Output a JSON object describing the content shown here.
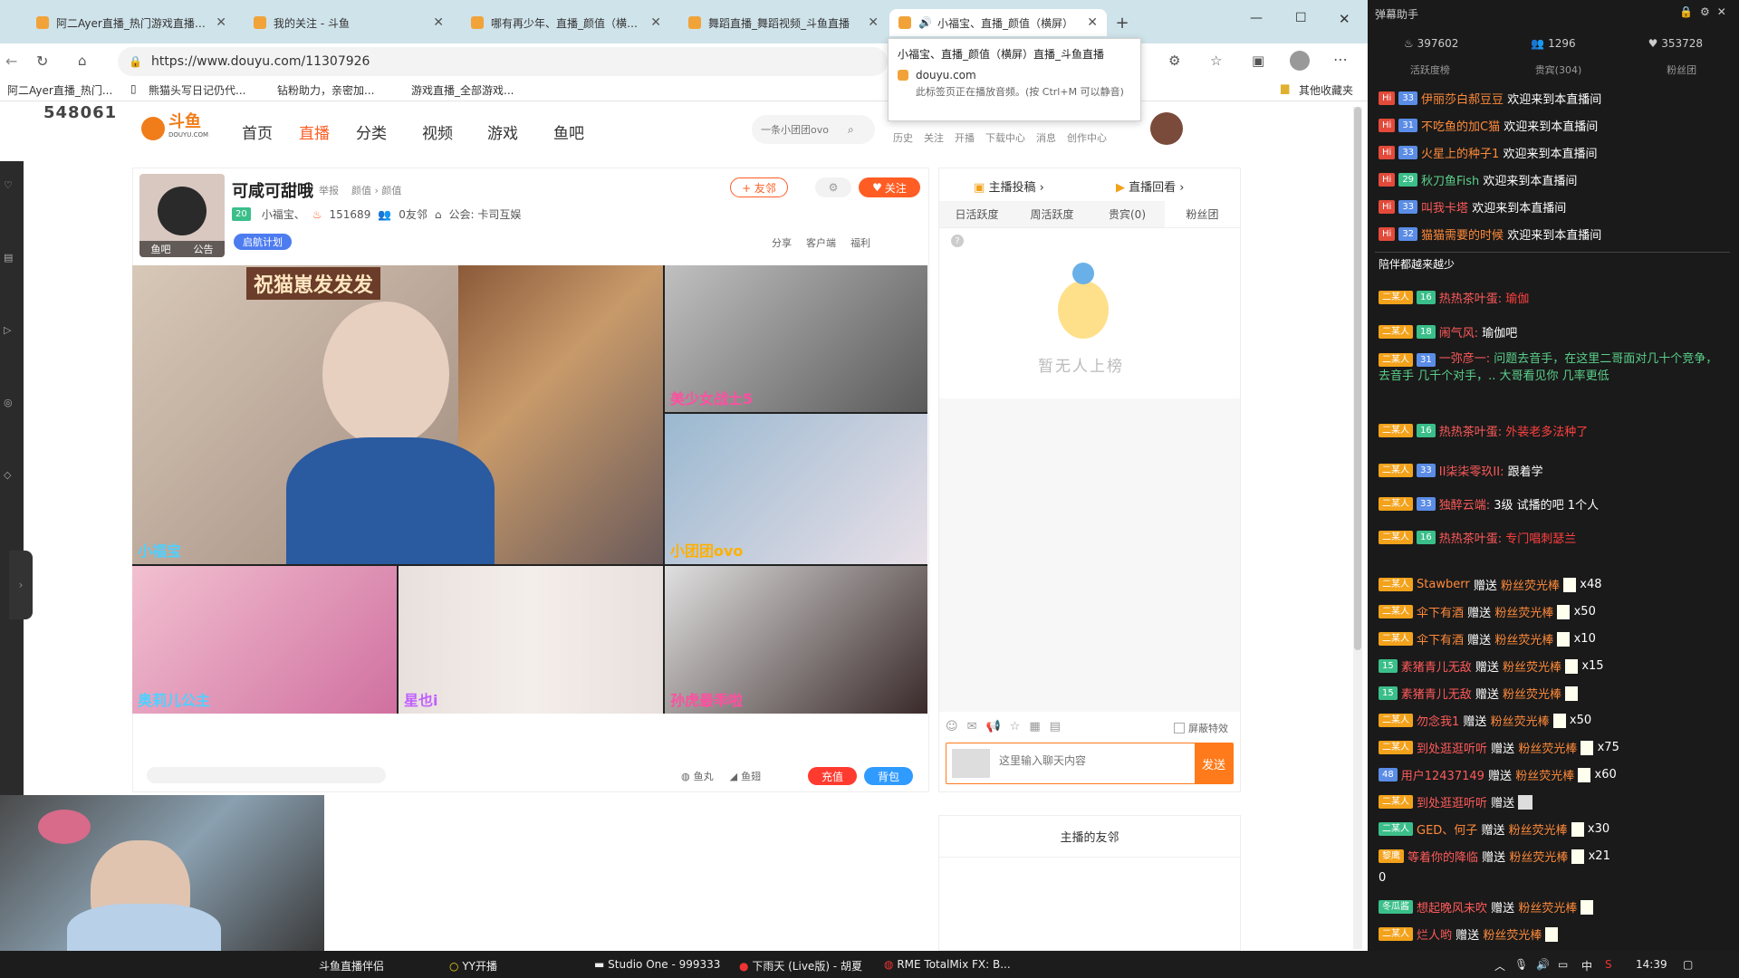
{
  "browser": {
    "tabs": [
      {
        "title": "阿二Ayer直播_热门游戏直播_斗鱼"
      },
      {
        "title": "我的关注 - 斗鱼"
      },
      {
        "title": "哪有再少年、直播_颜值（横屏）"
      },
      {
        "title": "舞蹈直播_舞蹈视频_斗鱼直播"
      },
      {
        "title": "小福宝、直播_颜值（横屏）"
      }
    ],
    "url": "https://www.douyu.com/11307926",
    "tooltip": {
      "title": "小福宝、直播_颜值（横屏）直播_斗鱼直播",
      "domain": "douyu.com",
      "note": "此标签页正在播放音频。(按 Ctrl+M 可以静音)"
    },
    "bookmarks": [
      {
        "label": "阿二Ayer直播_热门..."
      },
      {
        "label": "熊猫头写日记仍代..."
      },
      {
        "label": "钻粉助力，亲密加..."
      },
      {
        "label": "游戏直播_全部游戏..."
      }
    ],
    "other_bookmarks": "其他收藏夹"
  },
  "site": {
    "counter": "548061",
    "logo_text": "斗鱼",
    "logo_sub": "DOUYU.COM",
    "nav": [
      "首页",
      "直播",
      "分类",
      "视频",
      "游戏",
      "鱼吧"
    ],
    "search_placeholder": "一条小团团ovo",
    "top_icons": [
      "历史",
      "关注",
      "开播",
      "下载中心",
      "消息",
      "创作中心"
    ]
  },
  "streamer": {
    "name": "可咸可甜哦",
    "report": "举报",
    "category": "颜值 › 颜值",
    "level": "20",
    "fan_name": "小福宝、",
    "hot": "151689",
    "friends": "0友邻",
    "guild": "公会: 卡司互娱",
    "avatar_tabs": [
      "鱼吧",
      "公告"
    ],
    "plan_btn": "启航计划",
    "add_friend": "+ 友邻",
    "follow": "关注",
    "share": "分享",
    "client": "客户端",
    "welfare": "福利"
  },
  "video": {
    "banner": "祝猫崽发发发",
    "names": [
      "小福宝",
      "美少女战士5",
      "小团团ovo",
      "奥莉儿公主",
      "星也i",
      "孙虎最乖啦"
    ]
  },
  "gifts_bar": {
    "fishball": "鱼丸",
    "fishwing": "鱼翅",
    "recharge": "充值",
    "backpack": "背包"
  },
  "rank": {
    "top_links": [
      "主播投稿 ›",
      "直播回看 ›"
    ],
    "tabs": [
      "日活跃度",
      "周活跃度",
      "贵宾(0)",
      "粉丝团"
    ],
    "empty_text": "暂无人上榜",
    "chat_placeholder": "这里输入聊天内容",
    "send": "发送",
    "block": "屏蔽特效",
    "friends_title": "主播的友邻"
  },
  "danmu": {
    "title": "弹幕助手",
    "stats": [
      "397602",
      "1296",
      "353728"
    ],
    "subtabs": [
      "活跃度榜",
      "贵宾(304)",
      "粉丝团"
    ],
    "welcome": [
      {
        "lv": "33",
        "name": "伊丽莎白郝豆豆",
        "text": "欢迎来到本直播间"
      },
      {
        "lv": "31",
        "name": "不吃鱼的加C猫",
        "text": "欢迎来到本直播间"
      },
      {
        "lv": "33",
        "name": "火星上的种子1",
        "text": "欢迎来到本直播间"
      },
      {
        "lv": "29",
        "name": "秋刀鱼Fish",
        "text": "欢迎来到本直播间"
      },
      {
        "lv": "33",
        "name": "叫我卡塔",
        "text": "欢迎来到本直播间"
      },
      {
        "lv": "32",
        "name": "猫猫需要的时候",
        "text": "欢迎来到本直播间"
      }
    ],
    "divider": "陪伴都越来越少",
    "chats": [
      {
        "badge": "二某人",
        "lv": "16",
        "name": "热热茶叶蛋:",
        "text": "瑜伽"
      },
      {
        "badge": "二某人",
        "lv": "18",
        "name": "闹气风:",
        "text": "瑜伽吧"
      },
      {
        "badge": "二某人",
        "lv": "31",
        "name": "一弥彦一:",
        "text": "问题去音手，在这里二哥面对几十个竞争，去音手 几千个对手，.. 大哥看见你 几率更低"
      },
      {
        "badge": "二某人",
        "lv": "16",
        "name": "热热茶叶蛋:",
        "text": "外装老多法种了"
      },
      {
        "badge": "二某人",
        "lv": "33",
        "name": "II柒柒零玖II:",
        "text": "跟着学"
      },
      {
        "badge": "二某人",
        "lv": "33",
        "name": "独醉云端:",
        "text": "3级 试播的吧 1个人"
      },
      {
        "badge": "二某人",
        "lv": "16",
        "name": "热热茶叶蛋:",
        "text": "专门唱刺瑟兰"
      }
    ],
    "gifts": [
      {
        "name": "Stawberr",
        "count": "x48"
      },
      {
        "name": "伞下有酒",
        "count": "x50"
      },
      {
        "name": "伞下有酒",
        "count": "x10"
      },
      {
        "name": "素猪青儿无敌",
        "count": "x15"
      },
      {
        "name": "素猪青儿无敌",
        "count": ""
      },
      {
        "name": "勿念我1",
        "count": "x50"
      },
      {
        "name": "到处逛逛听听",
        "count": "x75"
      },
      {
        "name": "用户12437149",
        "count": "x60"
      },
      {
        "name": "到处逛逛听听",
        "count": ""
      },
      {
        "name": "GED、何子",
        "count": "x30"
      },
      {
        "name": "等着你的降临",
        "count": "x21"
      },
      {
        "name": "想起晚风未吹",
        "count": ""
      },
      {
        "name": "烂人哟",
        "count": ""
      }
    ],
    "gift_word": "赠送",
    "gift_item": "粉丝荧光棒",
    "extra_zero": "0"
  },
  "taskbar": {
    "items": [
      "斗鱼直播伴侣",
      "YY开播",
      "Studio One - 999333",
      "下雨天 (Live版) - 胡夏",
      "RME TotalMix FX: B..."
    ],
    "time": "14:39",
    "ime": "中"
  }
}
